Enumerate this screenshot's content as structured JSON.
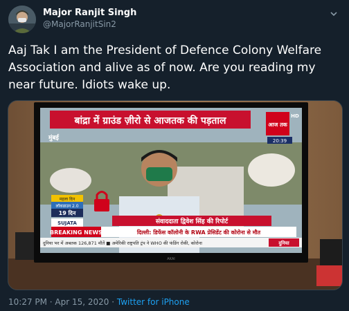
{
  "tweet": {
    "display_name": "Major Ranjit Singh",
    "handle": "@MajorRanjitSin2",
    "text": "Aaj Tak I am the President of Defence Colony Welfare Association and alive as of now. Are you reading my near future. Idiots wake up.",
    "timestamp": "10:27 PM · Apr 15, 2020 · ",
    "source": "Twitter for iPhone"
  },
  "media": {
    "headline": "बांद्रा में ग्राउंड ज़ीरो से आजतक की पड़ताल",
    "location": "मुंबई",
    "clock": "20:39",
    "lockdown_day_label": "महला दिन",
    "lockdown_label": "लॉकडाउन 2.0",
    "days_label": "19 दिन",
    "brand_label": "SUJATA",
    "reporter_label": "संवाददाता द्विवेश सिंह की रिपोर्ट",
    "breaking_label": "BREAKING NEWS",
    "breaking_text": "दिल्ली: डिफेंस कॉलोनी के RWA प्रेसिडेंट की कोरोना से मौत",
    "ticker_text": "दुनिया भर में अबतक 126,871 मौतें  ■  अमेरिकी राष्ट्रपति ट्रंप ने WHO की फंडिंग रोकी, कोरोना",
    "ticker_tag": "दुनिया",
    "channel_logo": "आज तक",
    "hd_label": "HD",
    "tv_brand": "AKAI"
  },
  "colors": {
    "background": "#15202b",
    "handle": "#8899a6",
    "link": "#1da1f2",
    "headline_red": "#c8102e",
    "breaking_red": "#d0021b"
  }
}
